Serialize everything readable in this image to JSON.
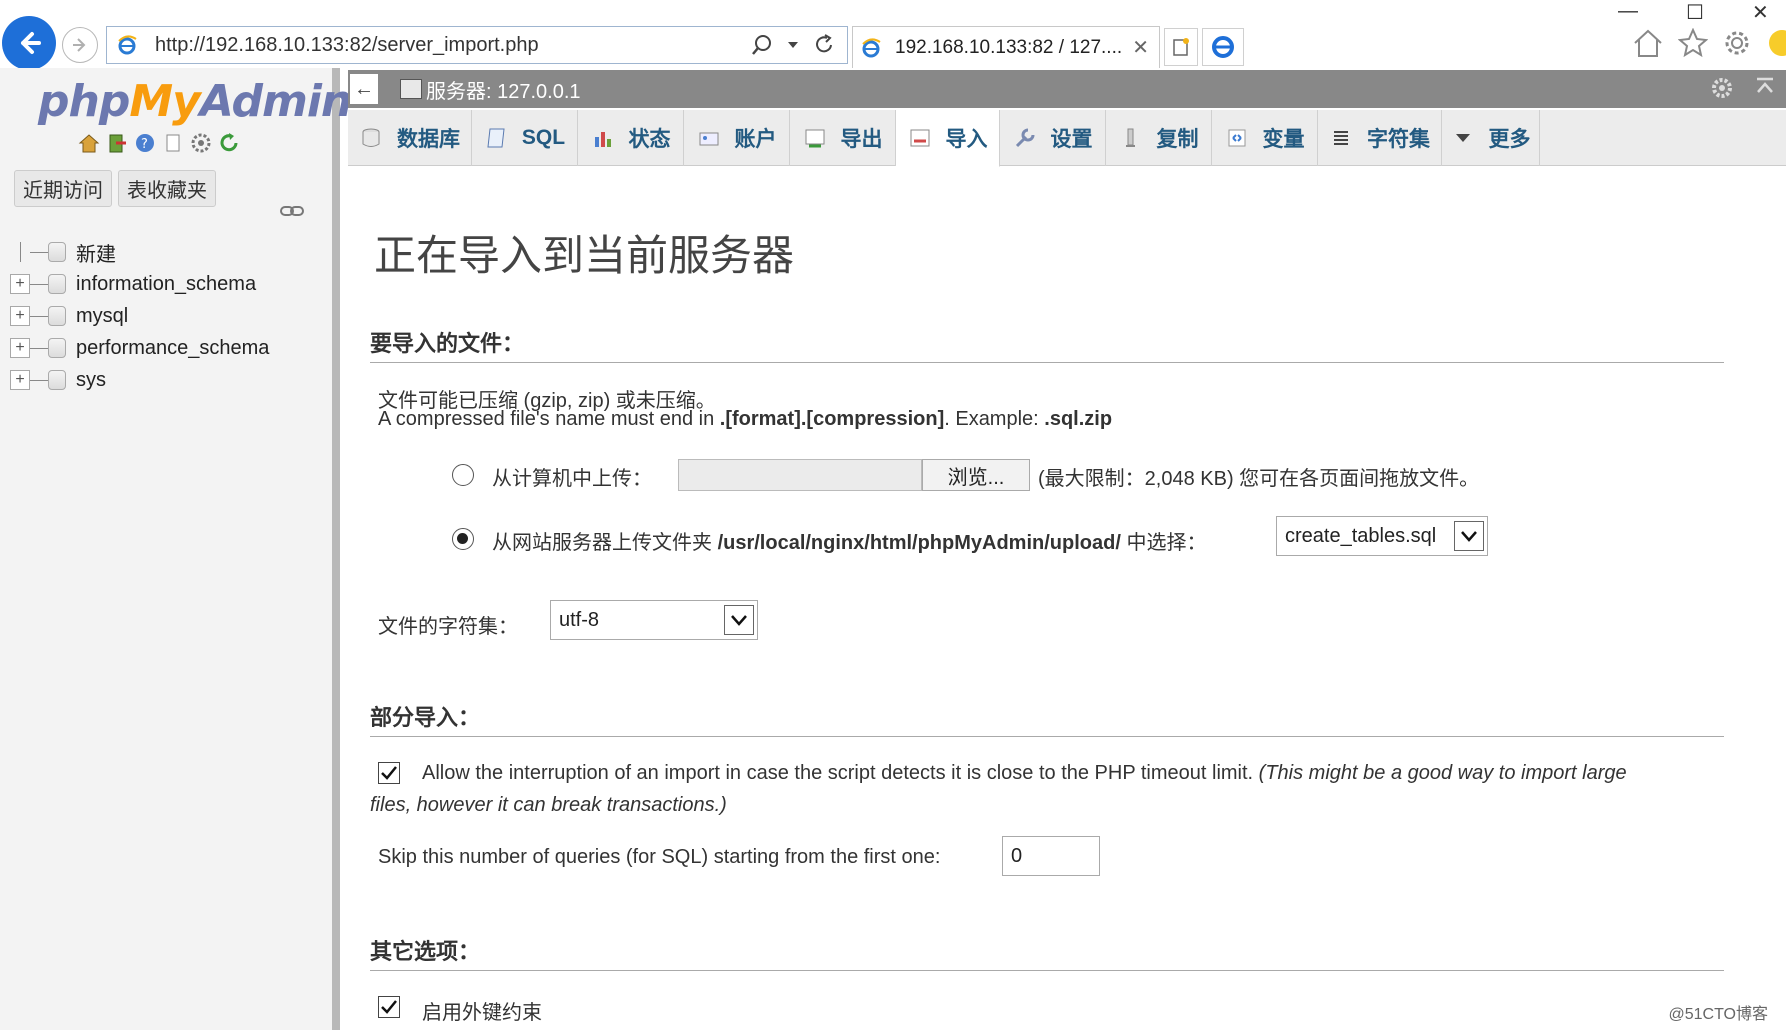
{
  "browser": {
    "url": "http://192.168.10.133:82/server_import.php",
    "tab_title": "192.168.10.133:82 / 127....",
    "tab_close": "✕",
    "win_min": "—",
    "win_max": "☐",
    "win_close": "✕"
  },
  "nav": {
    "logo_php": "php",
    "logo_my": "My",
    "logo_admin": "Admin",
    "tabs": [
      "近期访问",
      "表收藏夹"
    ],
    "tree": [
      {
        "label": "新建"
      },
      {
        "label": "information_schema"
      },
      {
        "label": "mysql"
      },
      {
        "label": "performance_schema"
      },
      {
        "label": "sys"
      }
    ],
    "expand_glyph": "+"
  },
  "serverbar": {
    "back_glyph": "←",
    "title": "服务器: 127.0.0.1"
  },
  "menu": [
    {
      "label": "数据库",
      "icon": "database-icon"
    },
    {
      "label": "SQL",
      "icon": "sql-icon"
    },
    {
      "label": "状态",
      "icon": "status-icon"
    },
    {
      "label": "账户",
      "icon": "accounts-icon"
    },
    {
      "label": "导出",
      "icon": "export-icon"
    },
    {
      "label": "导入",
      "icon": "import-icon",
      "active": true
    },
    {
      "label": "设置",
      "icon": "settings-wrench-icon"
    },
    {
      "label": "复制",
      "icon": "replication-icon"
    },
    {
      "label": "变量",
      "icon": "variables-icon"
    },
    {
      "label": "字符集",
      "icon": "charset-icon"
    },
    {
      "label": "更多",
      "icon": "more-icon"
    }
  ],
  "main": {
    "page_title": "正在导入到当前服务器",
    "file_section": "要导入的文件：",
    "compressed_line": "文件可能已压缩 (gzip, zip) 或未压缩。",
    "name_line_prefix": "A compressed file's name must end in ",
    "name_line_format": ".[format].[compression]",
    "name_line_mid": ". Example: ",
    "name_line_example": ".sql.zip",
    "upload_label": "从计算机中上传：",
    "browse_label": "浏览...",
    "upload_limit": "(最大限制：2,048 KB) 您可在各页面间拖放文件。",
    "server_dir_prefix": "从网站服务器上传文件夹 ",
    "server_dir_path": "/usr/local/nginx/html/phpMyAdmin/upload/",
    "server_dir_suffix": " 中选择：",
    "server_file_selected": "create_tables.sql",
    "charset_label": "文件的字符集：",
    "charset_selected": "utf-8",
    "partial_section": "部分导入：",
    "allow_interrupt_text": "Allow the interruption of an import in case the script detects it is close to the PHP timeout limit. ",
    "allow_interrupt_note_1": "(This might be a good way to import large",
    "allow_interrupt_note_2": "files, however it can break transactions.)",
    "skip_label": "Skip this number of queries (for SQL) starting from the first one:",
    "skip_value": "0",
    "other_section": "其它选项：",
    "fk_label": "启用外键约束"
  },
  "watermark": "@51CTO博客",
  "colors": {
    "accent_blue": "#235a81",
    "logo_blue": "#6c78af",
    "logo_orange": "#f89c0e",
    "serverbar_gray": "#888888"
  }
}
